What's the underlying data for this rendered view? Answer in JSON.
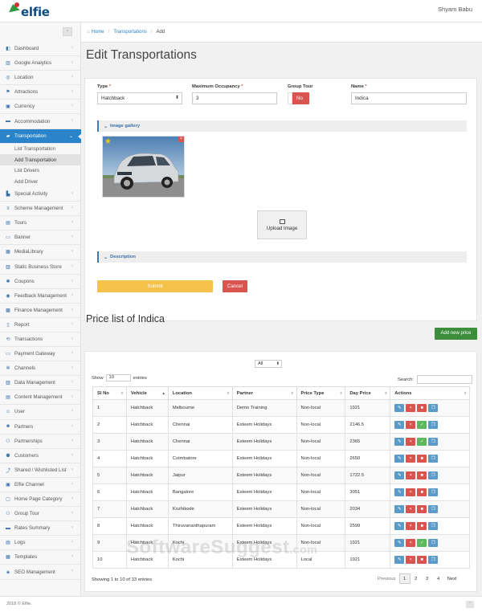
{
  "app": {
    "logo_text": "elfie",
    "user_name": "Shyam Babu"
  },
  "sidebar": {
    "items": [
      {
        "label": "Dashboard",
        "icon": "dashboard-icon",
        "glyph": "◧"
      },
      {
        "label": "Google Analytics",
        "icon": "analytics-icon",
        "glyph": "▥"
      },
      {
        "label": "Location",
        "icon": "location-icon",
        "glyph": "◎"
      },
      {
        "label": "Attractions",
        "icon": "attractions-icon",
        "glyph": "⚑"
      },
      {
        "label": "Currency",
        "icon": "currency-icon",
        "glyph": "▣"
      },
      {
        "label": "Accommodation",
        "icon": "bed-icon",
        "glyph": "▬"
      },
      {
        "label": "Transportation",
        "icon": "car-icon",
        "glyph": "▰"
      },
      {
        "label": "Special Activity",
        "icon": "activity-icon",
        "glyph": "▙"
      },
      {
        "label": "Scheme Management",
        "icon": "scheme-icon",
        "glyph": "≡"
      },
      {
        "label": "Tours",
        "icon": "tours-icon",
        "glyph": "▤"
      },
      {
        "label": "Banner",
        "icon": "banner-icon",
        "glyph": "▭"
      },
      {
        "label": "MediaLibrary",
        "icon": "media-icon",
        "glyph": "▦"
      },
      {
        "label": "Static Business Store",
        "icon": "store-icon",
        "glyph": "▨"
      },
      {
        "label": "Coupons",
        "icon": "coupon-icon",
        "glyph": "✱"
      },
      {
        "label": "Feedback Management",
        "icon": "feedback-icon",
        "glyph": "◉"
      },
      {
        "label": "Finance Management",
        "icon": "finance-icon",
        "glyph": "▩"
      },
      {
        "label": "Report",
        "icon": "report-icon",
        "glyph": "▯"
      },
      {
        "label": "Transactions",
        "icon": "transactions-icon",
        "glyph": "⟲"
      },
      {
        "label": "Payment Gateway",
        "icon": "payment-icon",
        "glyph": "▭"
      },
      {
        "label": "Channels",
        "icon": "channels-icon",
        "glyph": "✲"
      },
      {
        "label": "Data Management",
        "icon": "data-icon",
        "glyph": "▧"
      },
      {
        "label": "Content Management",
        "icon": "content-icon",
        "glyph": "▤"
      },
      {
        "label": "User",
        "icon": "user-icon",
        "glyph": "☺"
      },
      {
        "label": "Partners",
        "icon": "partners-icon",
        "glyph": "☻"
      },
      {
        "label": "Partnerships",
        "icon": "partnerships-icon",
        "glyph": "⚇"
      },
      {
        "label": "Customers",
        "icon": "customers-icon",
        "glyph": "⚉"
      },
      {
        "label": "Shared / Wishlisted List",
        "icon": "share-icon",
        "glyph": "⤴"
      },
      {
        "label": "Elfie Channel",
        "icon": "channel-icon",
        "glyph": "▣"
      },
      {
        "label": "Home Page Category",
        "icon": "category-icon",
        "glyph": "▢"
      },
      {
        "label": "Group Tour",
        "icon": "group-icon",
        "glyph": "⚇"
      },
      {
        "label": "Rates Summary",
        "icon": "rates-icon",
        "glyph": "▬"
      },
      {
        "label": "Logs",
        "icon": "logs-icon",
        "glyph": "▤"
      },
      {
        "label": "Templates",
        "icon": "templates-icon",
        "glyph": "▦"
      },
      {
        "label": "SEO Management",
        "icon": "seo-icon",
        "glyph": "◈"
      }
    ],
    "active_index": 6,
    "subitems": [
      "List Transportation",
      "Add Transportation",
      "List Drivers",
      "Add Driver"
    ],
    "current_sub_index": 1
  },
  "breadcrumb": {
    "home": "Home",
    "section": "Transportations",
    "current": "Add"
  },
  "page_title": "Edit Transportations",
  "form": {
    "type": {
      "label": "Type",
      "value": "Hatchback"
    },
    "occupancy": {
      "label": "Maximum Occupancy",
      "value": "3"
    },
    "group_tour": {
      "label": "Group Tour",
      "value": "No"
    },
    "name": {
      "label": "Name",
      "value": "Indica"
    },
    "gallery_label": "Image gallery",
    "upload_label": "Upload Image",
    "description_label": "Description",
    "submit_label": "Submit",
    "cancel_label": "Cancel"
  },
  "price": {
    "title": "Price list of Indica",
    "add_label": "Add new price",
    "filter_value": "All",
    "show_label": "Show",
    "show_value": "10",
    "entries_label": "entries",
    "search_label": "Search:",
    "columns": [
      "Sl No",
      "Vehicle",
      "Location",
      "Partner",
      "Price Type",
      "Day Price",
      "Actions"
    ],
    "rows": [
      [
        "1",
        "Hatchback",
        "Melbourne",
        "Demo Training",
        "Non-local",
        "1921",
        "lock"
      ],
      [
        "2",
        "Hatchback",
        "Chennai",
        "Esteem Holidays",
        "Non-local",
        "2146.5",
        "ok"
      ],
      [
        "3",
        "Hatchback",
        "Chennai",
        "Esteem Holidays",
        "Non-local",
        "2365",
        "ok"
      ],
      [
        "4",
        "Hatchback",
        "Coimbatore",
        "Esteem Holidays",
        "Non-local",
        "2650",
        "lock"
      ],
      [
        "5",
        "Hatchback",
        "Jaipur",
        "Esteem Holidays",
        "Non-local",
        "1722.5",
        "lock"
      ],
      [
        "6",
        "Hatchback",
        "Bangalore",
        "Esteem Holidays",
        "Non-local",
        "3051",
        "lock"
      ],
      [
        "7",
        "Hatchback",
        "Kozhikode",
        "Esteem Holidays",
        "Non-local",
        "2034",
        "lock"
      ],
      [
        "8",
        "Hatchback",
        "Thiruvananthapuram",
        "Esteem Holidays",
        "Non-local",
        "2599",
        "lock"
      ],
      [
        "9",
        "Hatchback",
        "Kochi",
        "Esteem Holidays",
        "Non-local",
        "1921",
        "ok"
      ],
      [
        "10",
        "Hatchback",
        "Kochi",
        "Esteem Holidays",
        "Local",
        "1921",
        "lock"
      ]
    ],
    "info": "Showing 1 to 10 of 33 entries",
    "pager": {
      "previous": "Previous",
      "pages": [
        "1",
        "2",
        "3",
        "4"
      ],
      "next": "Next",
      "current": "1"
    }
  },
  "footer": {
    "copyright": "2018 © Elfie."
  },
  "watermark": {
    "text": "SoftwareSuggest",
    "suffix": ".com"
  },
  "colors": {
    "primary": "#2a84c9",
    "danger": "#d9534f",
    "warning": "#f6c14a",
    "success": "#3c8d3c",
    "logo": "#0d4c86"
  }
}
